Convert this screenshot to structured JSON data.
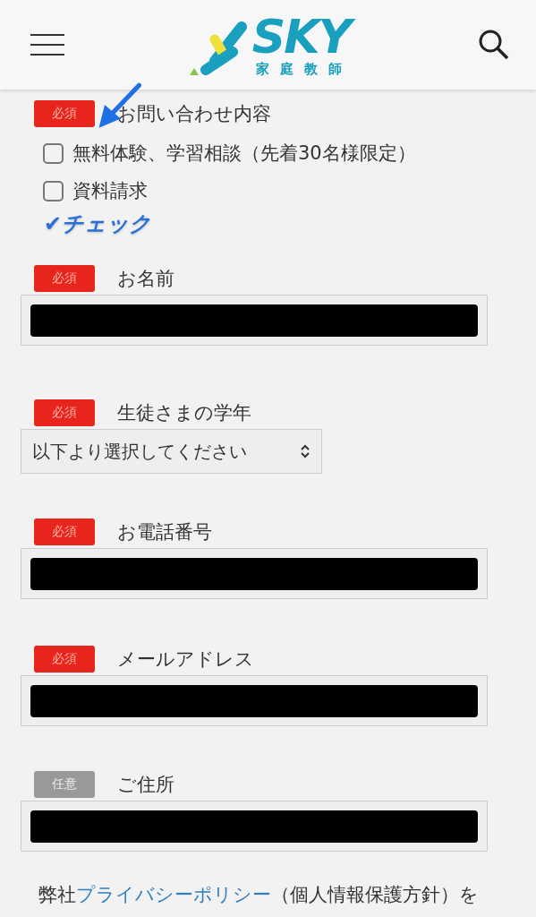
{
  "header": {
    "logo_text": "SKY",
    "logo_subtitle": "家庭教師"
  },
  "fields": [
    {
      "kind": "checkboxes",
      "badge": "必須",
      "required": true,
      "label": "お問い合わせ内容",
      "options": [
        {
          "label": "無料体験、学習相談（先着30名様限定）",
          "checked": false
        },
        {
          "label": "資料請求",
          "checked": false
        }
      ],
      "annotation": "✔チェック"
    },
    {
      "kind": "text",
      "badge": "必須",
      "required": true,
      "label": "お名前",
      "redacted": true
    },
    {
      "kind": "select",
      "badge": "必須",
      "required": true,
      "label": "生徒さまの学年",
      "value": "以下より選択してください"
    },
    {
      "kind": "text",
      "badge": "必須",
      "required": true,
      "label": "お電話番号",
      "redacted": true
    },
    {
      "kind": "text",
      "badge": "必須",
      "required": true,
      "label": "メールアドレス",
      "redacted": true
    },
    {
      "kind": "text",
      "badge": "任意",
      "required": false,
      "label": "ご住所",
      "redacted": true
    }
  ],
  "consent": {
    "before": "弊社",
    "link": "プライバシーポリシー",
    "after": "（個人情報保護方針）を"
  }
}
